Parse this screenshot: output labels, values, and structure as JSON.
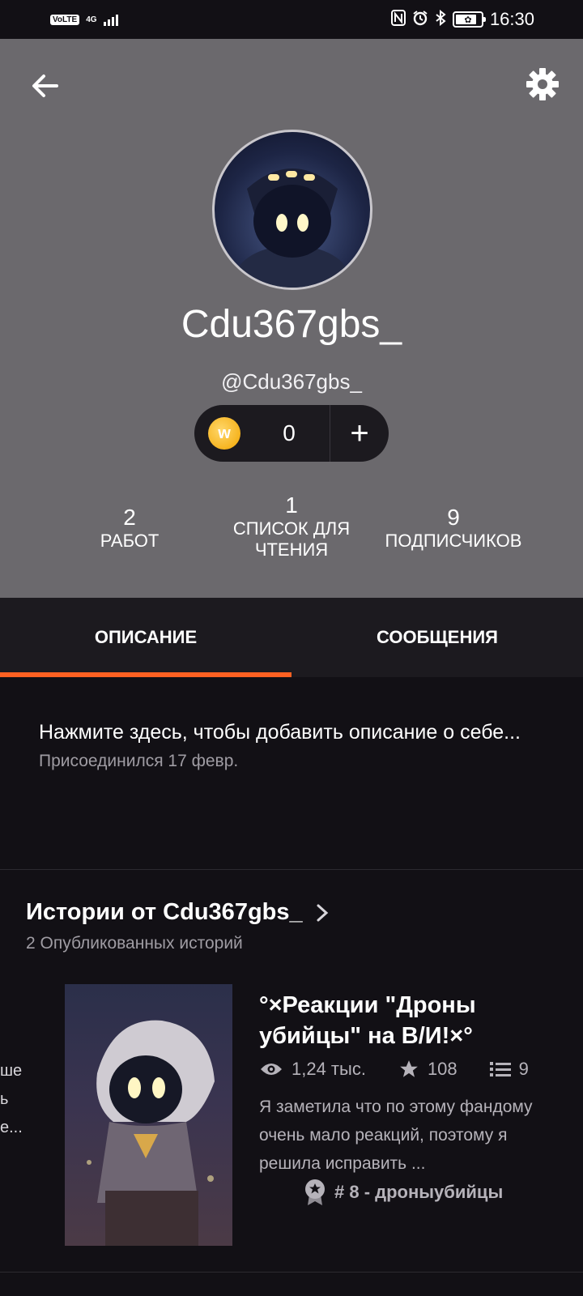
{
  "status_bar": {
    "volte": "VoLTE",
    "network": "4G",
    "time": "16:30",
    "battery_level": 0.85
  },
  "profile": {
    "username": "Cdu367gbs_",
    "handle": "@Cdu367gbs_",
    "coins": "0",
    "coin_symbol": "w",
    "add_symbol": "+"
  },
  "stats": [
    {
      "value": "2",
      "label": "РАБОТ"
    },
    {
      "value": "1",
      "label_line1": "СПИСОК ДЛЯ",
      "label_line2": "ЧТЕНИЯ"
    },
    {
      "value": "9",
      "label": "ПОДПИСЧИКОВ"
    }
  ],
  "tabs": [
    {
      "label": "ОПИСАНИЕ",
      "active": true
    },
    {
      "label": "СООБЩЕНИЯ",
      "active": false
    }
  ],
  "about": {
    "prompt": "Нажмите здесь, чтобы добавить описание о себе...",
    "joined": "Присоединился 17 февр."
  },
  "stories": {
    "title": "Истории от Cdu367gbs_",
    "subtitle": "2 Опубликованных историй",
    "peek_lines": [
      "ше",
      "ь",
      "е..."
    ],
    "items": [
      {
        "title": "°×Реакции \"Дроны убийцы\" на В/И!×°",
        "views": "1,24 тыс.",
        "votes": "108",
        "parts": "9",
        "description": "Я заметила что по этому фандому очень мало реакций, поэтому я решила исправить ...",
        "tag": "# 8 - дроныубийцы"
      }
    ]
  },
  "colors": {
    "header_bg": "#6b696d",
    "page_bg": "#121015",
    "accent": "#ff6122",
    "coin": "#f2a500"
  }
}
